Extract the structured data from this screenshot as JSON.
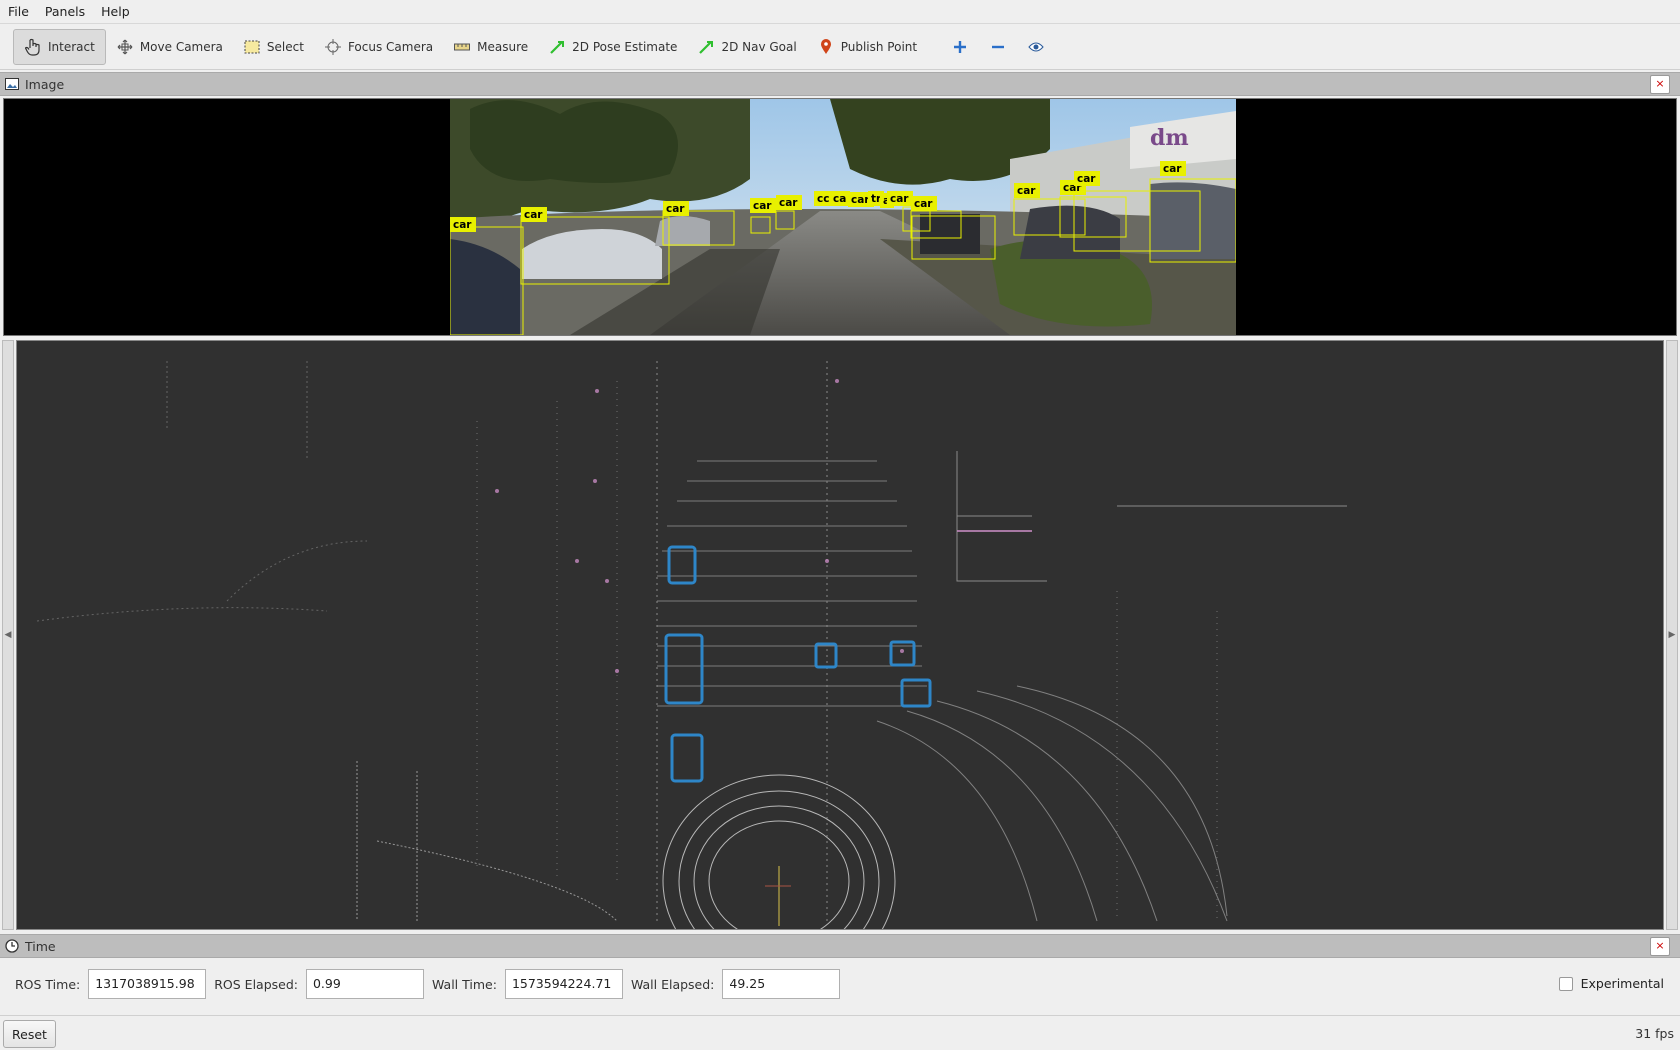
{
  "menu": {
    "file": "File",
    "panels": "Panels",
    "help": "Help"
  },
  "toolbar": {
    "interact": "Interact",
    "move_camera": "Move Camera",
    "select": "Select",
    "focus_camera": "Focus Camera",
    "measure": "Measure",
    "pose_estimate": "2D Pose Estimate",
    "nav_goal": "2D Nav Goal",
    "publish_point": "Publish Point"
  },
  "image_panel": {
    "title": "Image",
    "close": "×",
    "detections": [
      "car",
      "car",
      "car",
      "car",
      "car",
      "cc",
      "ca",
      "car",
      "tr",
      "a",
      "car",
      "car",
      "car",
      "car",
      "car",
      "car"
    ],
    "billboard": "dm"
  },
  "time_panel": {
    "title": "Time",
    "close": "×",
    "ros_time_label": "ROS Time:",
    "ros_time_value": "1317038915.98",
    "ros_elapsed_label": "ROS Elapsed:",
    "ros_elapsed_value": "0.99",
    "wall_time_label": "Wall Time:",
    "wall_time_value": "1573594224.71",
    "wall_elapsed_label": "Wall Elapsed:",
    "wall_elapsed_value": "49.25",
    "experimental_label": "Experimental"
  },
  "statusbar": {
    "reset": "Reset",
    "fps": "31 fps"
  },
  "colors": {
    "detection_box": "#e8f000",
    "tracked_box": "#2e86c8",
    "viewport_bg": "#303030"
  }
}
